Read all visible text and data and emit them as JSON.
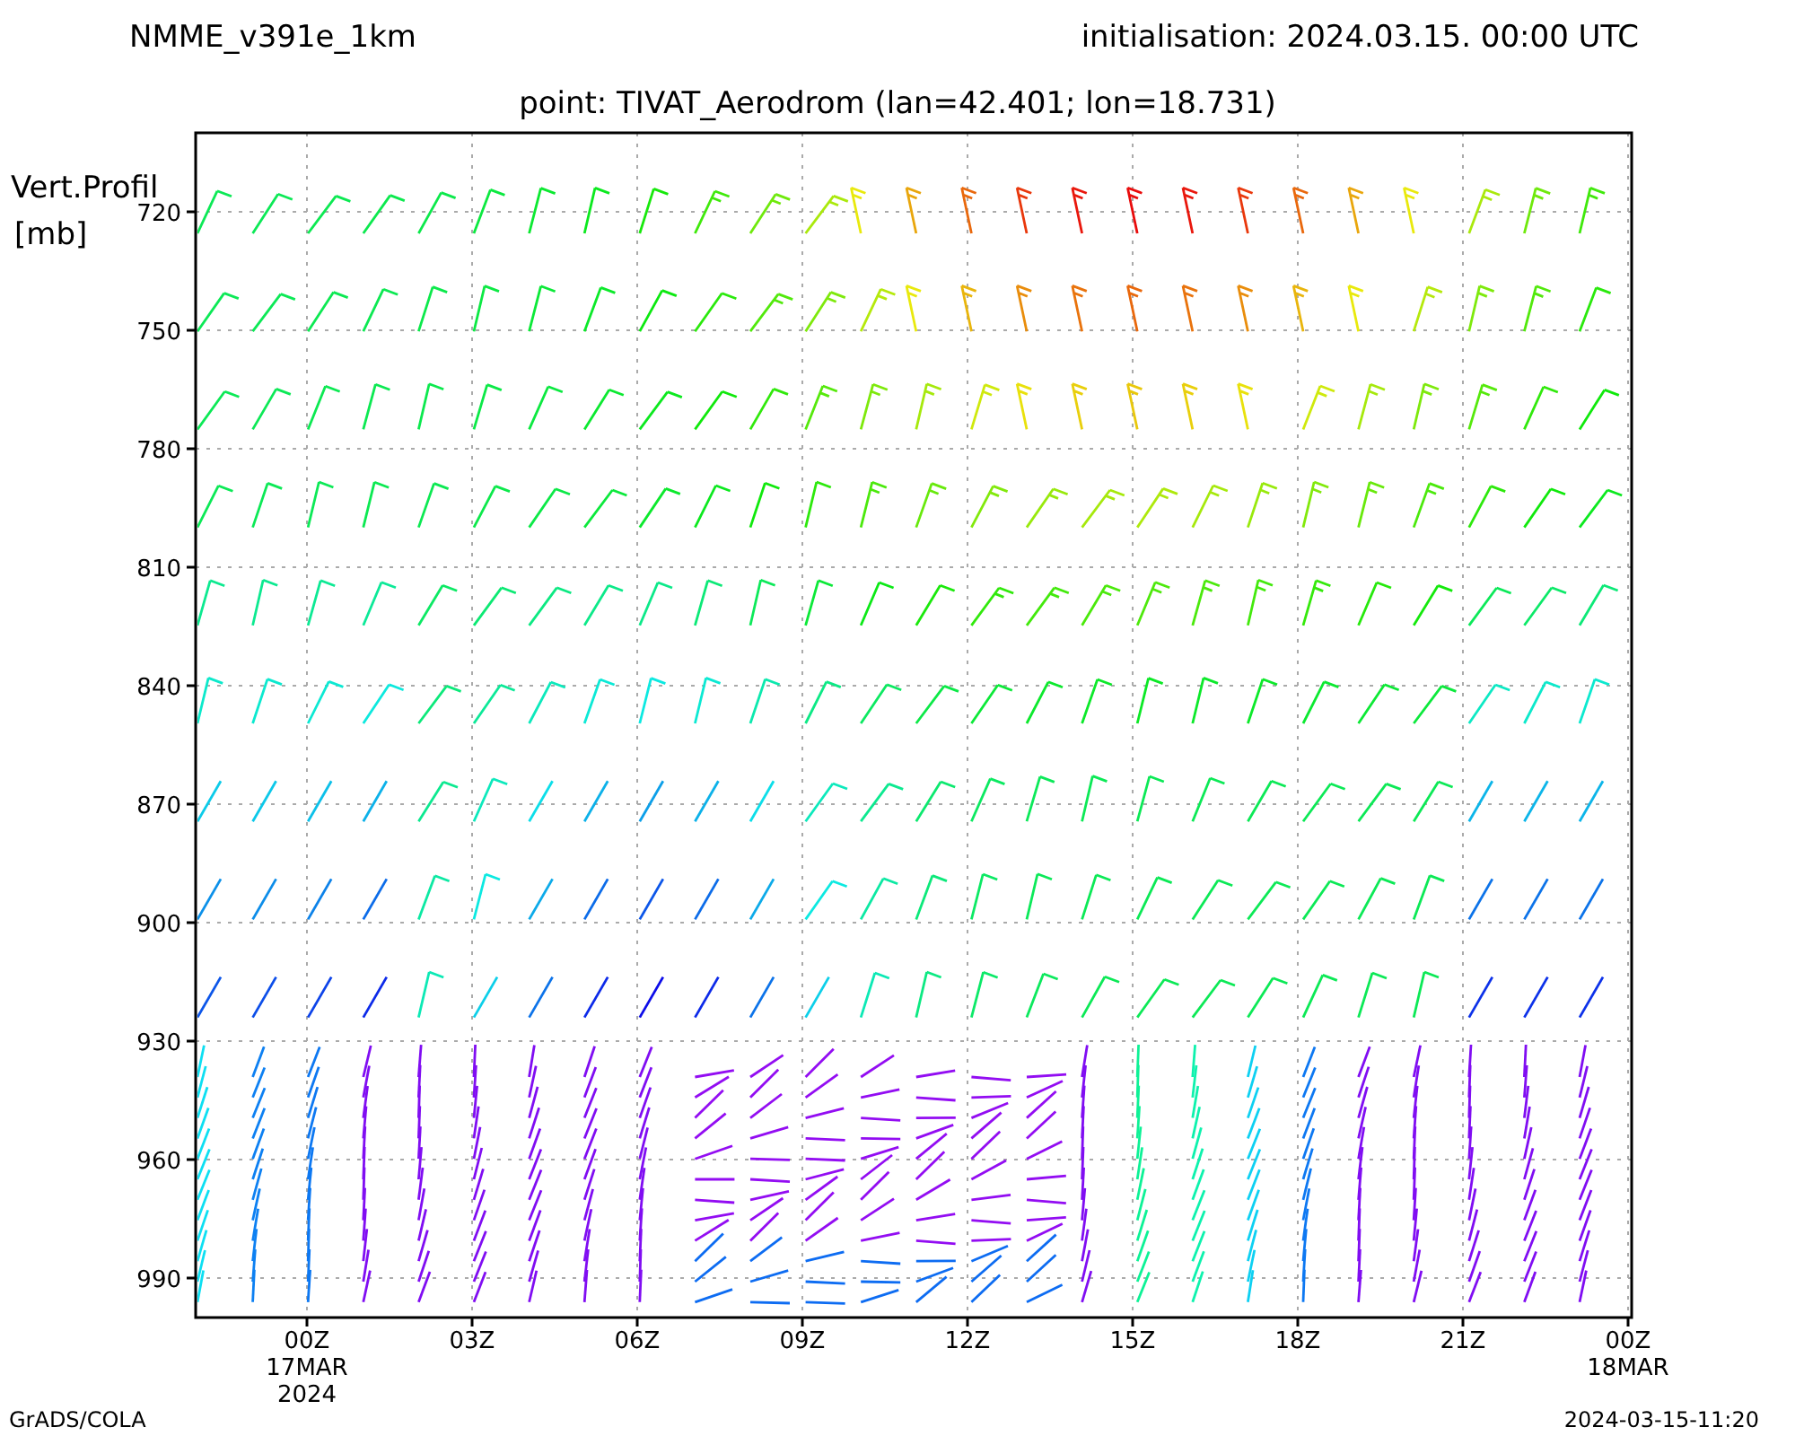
{
  "header": {
    "model": "NMME_v391e_1km",
    "initialisation": "initialisation: 2024.03.15. 00:00 UTC",
    "point": "point: TIVAT_Aerodrom (lan=42.401; lon=18.731)"
  },
  "y_axis": {
    "label_lines": [
      "Vert.Profil",
      "[mb]"
    ],
    "ticks": [
      "720",
      "750",
      "780",
      "810",
      "840",
      "870",
      "900",
      "930",
      "960",
      "990"
    ]
  },
  "x_axis": {
    "ticks": [
      {
        "lines": [
          "00Z",
          "17MAR",
          "2024"
        ]
      },
      {
        "lines": [
          "03Z"
        ]
      },
      {
        "lines": [
          "06Z"
        ]
      },
      {
        "lines": [
          "09Z"
        ]
      },
      {
        "lines": [
          "12Z"
        ]
      },
      {
        "lines": [
          "15Z"
        ]
      },
      {
        "lines": [
          "18Z"
        ]
      },
      {
        "lines": [
          "21Z"
        ]
      },
      {
        "lines": [
          "00Z",
          "18MAR"
        ]
      }
    ]
  },
  "footer": {
    "left": "GrADS/COLA",
    "right": "2024-03-15-11:20"
  }
}
